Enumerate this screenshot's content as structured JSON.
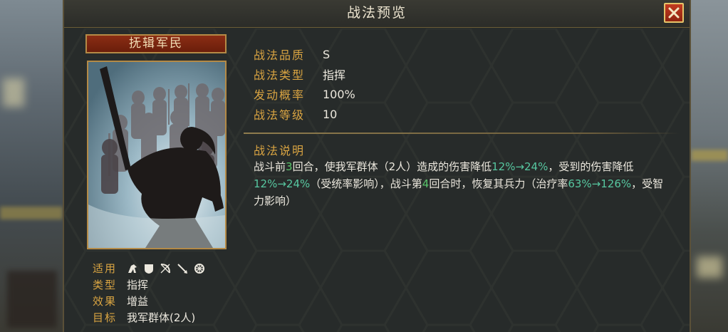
{
  "window": {
    "title": "战法预览"
  },
  "skill": {
    "name": "抚辑军民"
  },
  "stats": [
    {
      "label": "战法品质",
      "value": "S"
    },
    {
      "label": "战法类型",
      "value": "指挥"
    },
    {
      "label": "发动概率",
      "value": "100%"
    },
    {
      "label": "战法等级",
      "value": "10"
    }
  ],
  "description": {
    "title": "战法说明",
    "segments": [
      {
        "text": "战斗前",
        "hl": ""
      },
      {
        "text": "3",
        "hl": "hl"
      },
      {
        "text": "回合，使我军群体（2人）造成的伤害降低",
        "hl": ""
      },
      {
        "text": "12%→24%",
        "hl": "hl-g"
      },
      {
        "text": "，受到的伤害降低",
        "hl": ""
      },
      {
        "text": "12%→24%",
        "hl": "hl-g"
      },
      {
        "text": "（受统率影响），战斗第",
        "hl": ""
      },
      {
        "text": "4",
        "hl": "hl"
      },
      {
        "text": "回合时，恢复其兵力（治疗率",
        "hl": ""
      },
      {
        "text": "63%→126%",
        "hl": "hl-g"
      },
      {
        "text": "，受智力影响）",
        "hl": ""
      }
    ]
  },
  "meta": {
    "applicable_label": "适用",
    "applicable_icons": [
      "cavalry-icon",
      "shield-icon",
      "bow-icon",
      "spear-icon",
      "wheel-icon"
    ],
    "type_label": "类型",
    "type_value": "指挥",
    "effect_label": "效果",
    "effect_value": "增益",
    "target_label": "目标",
    "target_value": "我军群体(2人)"
  },
  "colors": {
    "label_gold": "#d9a442",
    "highlight_green": "#57c7a0",
    "plate_red": "#8b2d14",
    "close_red": "#c23a20"
  }
}
